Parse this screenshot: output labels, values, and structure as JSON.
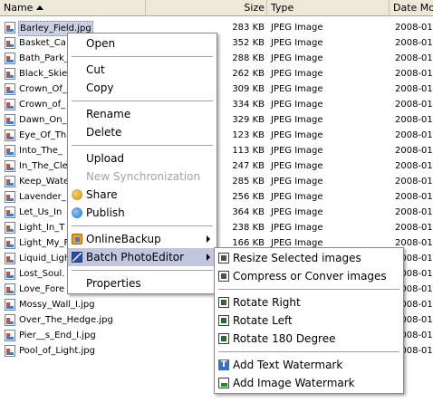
{
  "columns": {
    "name": "Name",
    "size": "Size",
    "type": "Type",
    "date": "Date Mo"
  },
  "files": [
    {
      "name": "Barley_Field.jpg",
      "size": "283 KB",
      "type": "JPEG Image",
      "date": "2008-01-"
    },
    {
      "name": "Basket_Ca",
      "size": "352 KB",
      "type": "JPEG Image",
      "date": "2008-01-"
    },
    {
      "name": "Bath_Park_",
      "size": "288 KB",
      "type": "JPEG Image",
      "date": "2008-01-"
    },
    {
      "name": "Black_Skies",
      "size": "262 KB",
      "type": "JPEG Image",
      "date": "2008-01-"
    },
    {
      "name": "Crown_Of_",
      "size": "309 KB",
      "type": "JPEG Image",
      "date": "2008-01-"
    },
    {
      "name": "Crown_of_",
      "size": "334 KB",
      "type": "JPEG Image",
      "date": "2008-01-"
    },
    {
      "name": "Dawn_On_",
      "size": "329 KB",
      "type": "JPEG Image",
      "date": "2008-01-"
    },
    {
      "name": "Eye_Of_Th",
      "size": "123 KB",
      "type": "JPEG Image",
      "date": "2008-01-"
    },
    {
      "name": "Into_The_",
      "size": "113 KB",
      "type": "JPEG Image",
      "date": "2008-01-"
    },
    {
      "name": "In_The_Cle",
      "size": "247 KB",
      "type": "JPEG Image",
      "date": "2008-01-"
    },
    {
      "name": "Keep_Wate",
      "size": "285 KB",
      "type": "JPEG Image",
      "date": "2008-01-"
    },
    {
      "name": "Lavender_",
      "size": "256 KB",
      "type": "JPEG Image",
      "date": "2008-01-"
    },
    {
      "name": "Let_Us_In",
      "size": "364 KB",
      "type": "JPEG Image",
      "date": "2008-01-"
    },
    {
      "name": "Light_In_T",
      "size": "238 KB",
      "type": "JPEG Image",
      "date": "2008-01-"
    },
    {
      "name": "Light_My_F",
      "size": "166 KB",
      "type": "JPEG Image",
      "date": "2008-01-"
    },
    {
      "name": "Liquid_Ligh",
      "size": "",
      "type": "",
      "date": "2008-01-"
    },
    {
      "name": "Lost_Soul.",
      "size": "",
      "type": "",
      "date": "2008-01-"
    },
    {
      "name": "Love_Fore",
      "size": "",
      "type": "",
      "date": "2008-01-"
    },
    {
      "name": "Mossy_Wall_I.jpg",
      "size": "",
      "type": "",
      "date": "2008-01-"
    },
    {
      "name": "Over_The_Hedge.jpg",
      "size": "",
      "type": "",
      "date": "2008-01-"
    },
    {
      "name": "Pier__s_End_I.jpg",
      "size": "",
      "type": "",
      "date": "2008-01-"
    },
    {
      "name": "Pool_of_Light.jpg",
      "size": "",
      "type": "",
      "date": "2008-01-"
    }
  ],
  "context_menu": {
    "open": "Open",
    "cut": "Cut",
    "copy": "Copy",
    "rename": "Rename",
    "delete": "Delete",
    "upload": "Upload",
    "new_sync": "New Synchronization",
    "share": "Share",
    "publish": "Publish",
    "online_backup": "OnlineBackup",
    "batch_photo_editor": "Batch PhotoEditor",
    "properties": "Properties"
  },
  "submenu": {
    "resize": "Resize Selected images",
    "compress": "Compress or Conver images",
    "rotate_right": "Rotate Right",
    "rotate_left": "Rotate Left",
    "rotate_180": "Rotate 180 Degree",
    "add_text_watermark": "Add Text Watermark",
    "add_image_watermark": "Add Image Watermark"
  },
  "icons": {
    "text_watermark_glyph": "T"
  },
  "colors": {
    "menu_highlight": "#c1c7de",
    "selection": "#cbd0e3",
    "header_bg": "#ece9d8"
  }
}
